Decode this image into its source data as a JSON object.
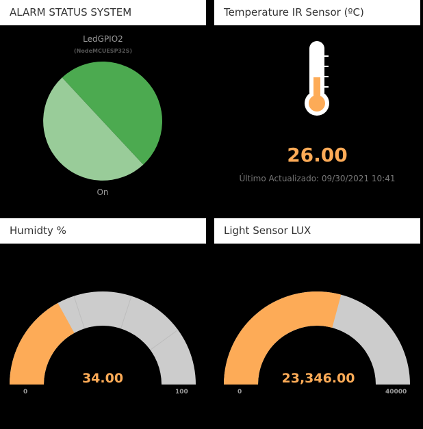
{
  "widgets": {
    "alarm": {
      "title": "ALARM STATUS SYSTEM",
      "chart_title": "LedGPIO2",
      "chart_subtitle": "(NodeMCUESP32S)",
      "slice_label": "On",
      "colors": {
        "light": "#99cc99",
        "dark": "#4caa50"
      }
    },
    "temperature": {
      "title": "Temperature IR Sensor (ºC)",
      "value": "26.00",
      "updated": "Último Actualizado: 09/30/2021 10:41",
      "icon": "thermometer-icon",
      "accent": "#fdab57"
    },
    "humidity": {
      "title": "Humidty %",
      "value": "34.00",
      "numeric": 34,
      "min": "0",
      "max": "100",
      "min_num": 0,
      "max_num": 100,
      "accent": "#fdab57",
      "track": "#cccccc"
    },
    "light": {
      "title": "Light Sensor LUX",
      "value": "23,346.00",
      "numeric": 23346,
      "min": "0",
      "max": "40000",
      "min_num": 0,
      "max_num": 40000,
      "accent": "#fdab57",
      "track": "#cccccc"
    }
  }
}
